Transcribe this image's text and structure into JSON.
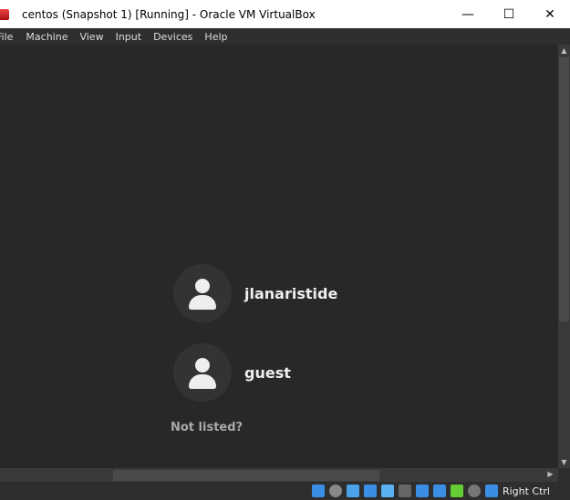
{
  "window": {
    "title": "centos (Snapshot 1) [Running] - Oracle VM VirtualBox",
    "minimize": "—",
    "maximize": "☐",
    "close": "✕"
  },
  "menu": [
    "File",
    "Machine",
    "View",
    "Input",
    "Devices",
    "Help"
  ],
  "login": {
    "users": [
      {
        "name": "jlanaristide"
      },
      {
        "name": "guest"
      }
    ],
    "not_listed": "Not listed?"
  },
  "status": {
    "host_key": "Right Ctrl",
    "icons": [
      "hard-disk",
      "optical-drive",
      "audio",
      "network",
      "usb",
      "shared-folders",
      "display",
      "video-capture",
      "cpu",
      "mouse-integration",
      "keyboard-capture"
    ]
  }
}
